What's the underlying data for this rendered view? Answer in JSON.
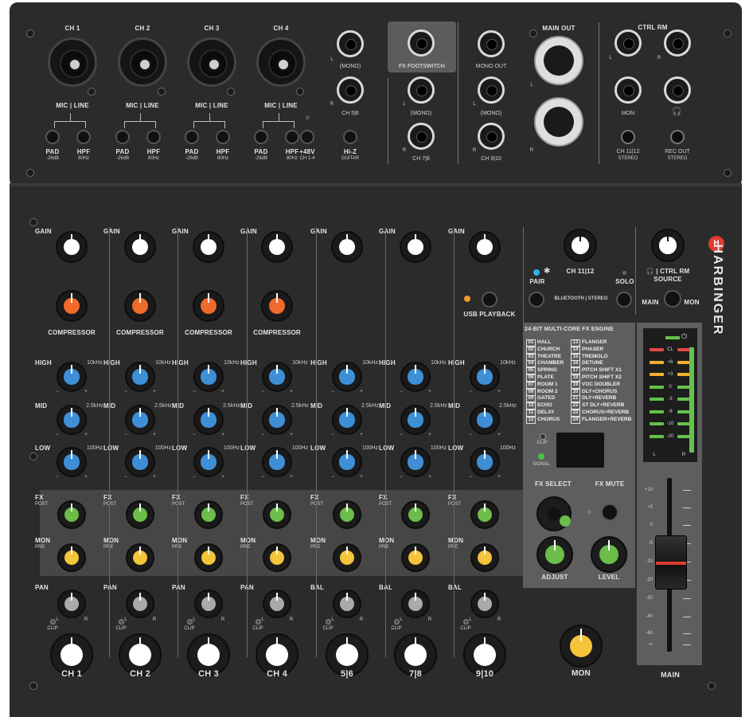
{
  "inputs": {
    "channels": [
      {
        "name": "CH 1",
        "mic_line": "MIC | LINE",
        "pad": "PAD",
        "pad_sub": "-26dB",
        "hpf": "HPF",
        "hpf_sub": "80Hz"
      },
      {
        "name": "CH 2",
        "mic_line": "MIC | LINE",
        "pad": "PAD",
        "pad_sub": "-26dB",
        "hpf": "HPF",
        "hpf_sub": "80Hz"
      },
      {
        "name": "CH 3",
        "mic_line": "MIC | LINE",
        "pad": "PAD",
        "pad_sub": "-26dB",
        "hpf": "HPF",
        "hpf_sub": "80Hz"
      },
      {
        "name": "CH 4",
        "mic_line": "MIC | LINE",
        "pad": "PAD",
        "pad_sub": "-26dB",
        "hpf": "HPF",
        "hpf_sub": "80Hz"
      }
    ],
    "phantom": "+48V",
    "phantom_sub": "CH 1-4",
    "hiz": "Hi-Z",
    "hiz_sub": "GUITAR",
    "ch56": {
      "l": "L",
      "r": "R",
      "mono": "(MONO)",
      "name": "CH 5|6"
    },
    "fx_footswitch": "FX FOOTSWITCH",
    "ch78": {
      "l": "L",
      "r": "R",
      "mono": "(MONO)",
      "name": "CH 7|8"
    },
    "mono_out": "MONO OUT",
    "ch910": {
      "l": "L",
      "r": "R",
      "mono": "(MONO)",
      "name": "CH 9|10"
    },
    "main_out": {
      "label": "MAIN OUT",
      "l": "L",
      "r": "R"
    },
    "ctrl_rm": {
      "label": "CTRL RM",
      "l": "L",
      "r": "R",
      "mon": "MON",
      "ch1112": "CH 11|12",
      "ch1112_sub": "STEREO",
      "rec_out": "REC OUT",
      "rec_out_sub": "STEREO"
    }
  },
  "strips": {
    "gain": "GAIN",
    "compressor": "COMPRESSOR",
    "high": "HIGH",
    "high_freq": "10kHz",
    "mid": "MID",
    "mid_freq": "2.5kHz",
    "low": "LOW",
    "low_freq": "100Hz",
    "fx": "FX",
    "fx_sub": "POST",
    "mon": "MON",
    "mon_sub": "PRE",
    "pan": "PAN",
    "bal": "BAL",
    "clip": "CLIP",
    "minus": "−",
    "plus": "+",
    "l": "L",
    "r": "R",
    "names": [
      "CH 1",
      "CH 2",
      "CH 3",
      "CH 4",
      "5|6",
      "7|8",
      "9|10"
    ]
  },
  "usb": {
    "label": "USB PLAYBACK"
  },
  "bt": {
    "ch": "CH 11|12",
    "pair": "PAIR",
    "solo": "SOLO",
    "bt_stereo": "BLUETOOTH | STEREO"
  },
  "ctrl": {
    "label": "🎧 | CTRL RM",
    "source": "SOURCE",
    "main": "MAIN",
    "mon": "MON"
  },
  "fx_engine": {
    "title": "24-BIT MULTI-CORE FX ENGINE",
    "effects": [
      {
        "n": "01",
        "name": "HALL"
      },
      {
        "n": "02",
        "name": "CHURCH"
      },
      {
        "n": "03",
        "name": "THEATRE"
      },
      {
        "n": "04",
        "name": "CHAMBER"
      },
      {
        "n": "05",
        "name": "SPRING"
      },
      {
        "n": "06",
        "name": "PLATE"
      },
      {
        "n": "07",
        "name": "ROOM 1"
      },
      {
        "n": "08",
        "name": "ROOM 2"
      },
      {
        "n": "09",
        "name": "GATED"
      },
      {
        "n": "10",
        "name": "ECHO"
      },
      {
        "n": "11",
        "name": "DELAY"
      },
      {
        "n": "12",
        "name": "CHORUS"
      },
      {
        "n": "13",
        "name": "FLANGER"
      },
      {
        "n": "14",
        "name": "PHASER"
      },
      {
        "n": "15",
        "name": "TREMOLO"
      },
      {
        "n": "16",
        "name": "DETUNE"
      },
      {
        "n": "17",
        "name": "PITCH SHIFT X1"
      },
      {
        "n": "18",
        "name": "PITCH SHIFT X2"
      },
      {
        "n": "19",
        "name": "VOC DOUBLER"
      },
      {
        "n": "20",
        "name": "DLY+CHORUS"
      },
      {
        "n": "21",
        "name": "DLY+REVERB"
      },
      {
        "n": "22",
        "name": "ST DLY+REVERB"
      },
      {
        "n": "23",
        "name": "CHORUS+REVERB"
      },
      {
        "n": "24",
        "name": "FLANGER+REVERB"
      }
    ],
    "clip": "CLIP",
    "signal": "SIGNAL",
    "fx_select": "FX SELECT",
    "fx_mute": "FX MUTE",
    "adjust": "ADJUST",
    "level": "LEVEL"
  },
  "meter": {
    "labels": [
      "CL",
      "+6",
      "+3",
      "0",
      "-3",
      "-6",
      "-10",
      "-20"
    ],
    "l": "L",
    "r": "R",
    "colors": {
      "red": "#e2483f",
      "amber": "#f2b12c",
      "green": "#64c24a"
    }
  },
  "fader": {
    "scale": [
      "+10",
      "+5",
      "0",
      "-5",
      "-10",
      "-20",
      "-30",
      "-40",
      "-60",
      "-∞"
    ],
    "label": "MAIN"
  },
  "mon_master": "MON",
  "brand": "HARBINGER",
  "colors": {
    "gain": "#ffffff",
    "comp": "#f06a2c",
    "eq": "#3f8fd6",
    "fx": "#6cbd4a",
    "mon": "#f4c43a",
    "pan": "#aaaaaa",
    "level": "#ffffff",
    "accent": "#e03c31"
  }
}
